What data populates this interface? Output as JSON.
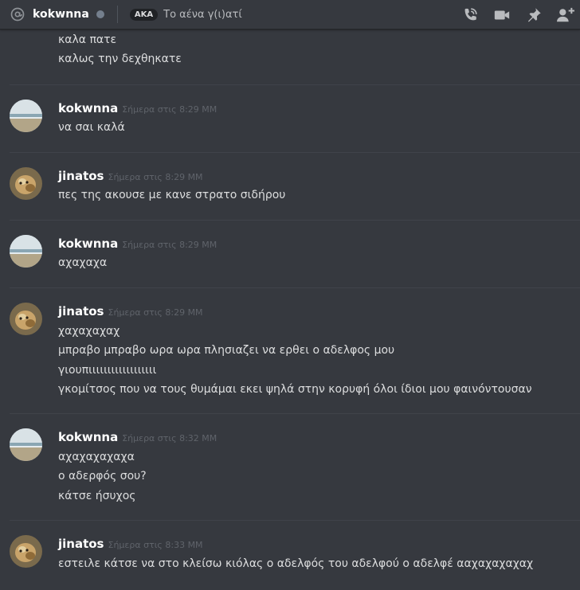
{
  "header": {
    "title": "kokwnna",
    "aka_badge": "AKA",
    "aka_names": "Το αένα γ(ι)ατί",
    "icons": [
      "start-voice-call-icon",
      "start-video-call-icon",
      "pinned-messages-icon",
      "add-friends-to-dm-icon"
    ]
  },
  "messages": [
    {
      "lines": [
        "καλα πατε",
        "καλως την δεχθηκατε"
      ]
    },
    {
      "author": "kokwnna",
      "timestamp": "Σήμερα στις 8:29 ΜΜ",
      "lines": [
        "να σαι καλά"
      ]
    },
    {
      "author": "jinatos",
      "timestamp": "Σήμερα στις 8:29 ΜΜ",
      "lines": [
        "πες της ακουσε με κανε στρατο σιδήρου"
      ]
    },
    {
      "author": "kokwnna",
      "timestamp": "Σήμερα στις 8:29 ΜΜ",
      "lines": [
        "αχαχαχα"
      ]
    },
    {
      "author": "jinatos",
      "timestamp": "Σήμερα στις 8:29 ΜΜ",
      "lines": [
        "χαχαχαχαχ",
        "μπραβο μπραβο ωρα ωρα πλησιαζει να ερθει ο αδελφος μου",
        "γιουπιιιιιιιιιιιιιιιιιι",
        "γκομίτσος που να τους θυμάμαι εκει ψηλά στην κορυφή όλοι ίδιοι μου φαινόντουσαν"
      ]
    },
    {
      "author": "kokwnna",
      "timestamp": "Σήμερα στις 8:32 ΜΜ",
      "lines": [
        "αχαχαχαχαχα",
        "ο αδερφός σου?",
        "κάτσε ήσυχος"
      ]
    },
    {
      "author": "jinatos",
      "timestamp": "Σήμερα στις 8:33 ΜΜ",
      "lines": [
        "εστειλε κάτσε να στο κλείσω κιόλας ο αδελφός του αδελφού ο αδελφέ ααχαχαχαχαχ"
      ]
    }
  ],
  "colors": {
    "background": "#36393f",
    "author": "#ffffff",
    "message_text": "#dcddde",
    "timestamp": "#5f636a",
    "icon": "#b9bbbe"
  }
}
